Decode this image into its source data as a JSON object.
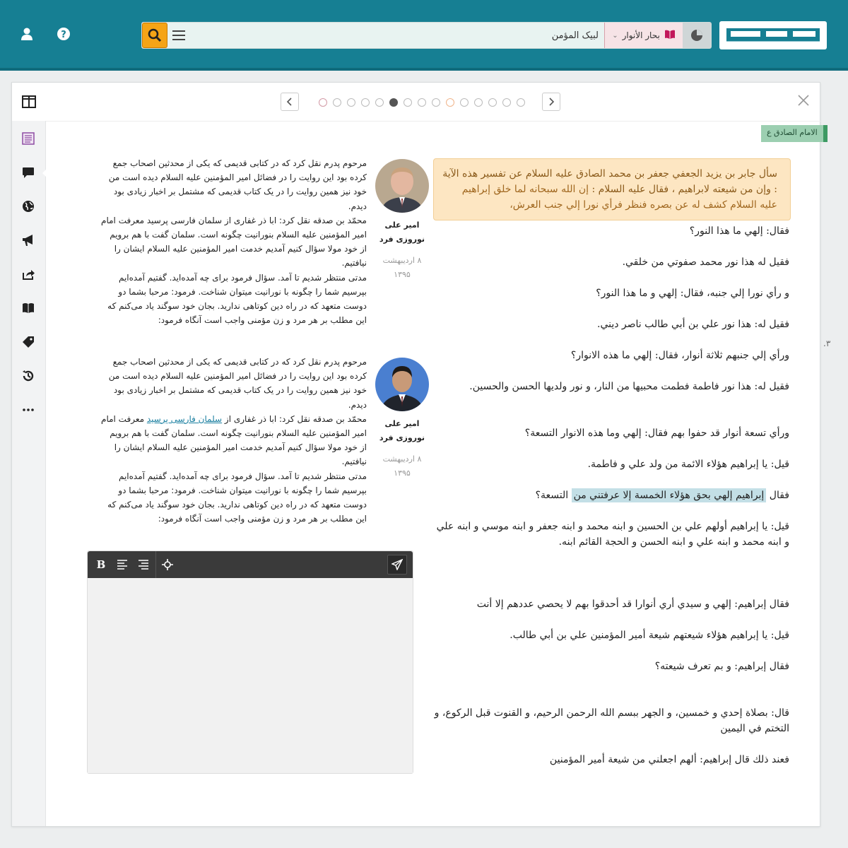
{
  "header": {
    "search": {
      "value": "لبیک المؤمن",
      "placeholder": ""
    },
    "book": {
      "label": "بحار الأنوار"
    },
    "icons": [
      "search-icon",
      "menu-icon",
      "book-icon",
      "pie-chart-icon",
      "help-icon",
      "user-icon"
    ],
    "colors": {
      "bar": "#167f93",
      "search_button": "#f5a416",
      "book_select": "#f6e3e6"
    }
  },
  "pager": {
    "page_count": 15,
    "active_index": 5,
    "marked_indices": [
      0,
      9
    ]
  },
  "hadith": {
    "tag": "الامام الصادق ع",
    "side_number": "۳.",
    "intro": "سأل جابر بن يزيد الجعفي جعفر بن محمد الصادق عليه السلام عن تفسير هذه الآية : وإن من شيعته لابراهيم ، فقال عليه السلام : ",
    "intro_body": "إن الله سبحانه لما خلق إبراهيم عليه السلام كشف له عن بصره فنظر فرأي نورا إلي جنب العرش،",
    "lines": [
      "فقال: إلهي ما هذا النور؟",
      "فقيل له هذا نور محمد صفوتي من خلقي.",
      "و رأي نورا إلي جنبه، فقال: إلهي و ما هذا النور؟",
      "فقيل له: هذا نور علي بن أبي طالب ناصر ديني.",
      "ورأي إلي جنبهم ثلاثة أنوار، فقال: إلهي ما هذه الانوار؟",
      "فقيل له: هذا نور فاطمة فطمت محبيها من النار، و نور ولديها الحسن والحسين.",
      "ورأي تسعة أنوار قد حفوا بهم فقال: إلهي وما هذه الانوار التسعة؟",
      "قيل: يا إبراهيم هؤلاء الائمة من ولد علي و فاطمة."
    ],
    "highlight_pre": "فقال ",
    "highlight": "إبراهيم إلهي بحق هؤلاء الخمسة إلا عرفتني من",
    "highlight_post": " التسعة؟",
    "lines2": [
      "قيل: يا إبراهيم أولهم علي بن الحسين و ابنه محمد و ابنه جعفر و ابنه موسي و ابنه علي و ابنه محمد و ابنه علي و ابنه الحسن و الحجة القائم ابنه.",
      "فقال إبراهيم: إلهي و سيدي أري أنوارا قد أحدقوا بهم لا يحصي عددهم إلا أنت",
      "قيل: يا إبراهيم هؤلاء شيعتهم شيعة أمير المؤمنين علي بن أبي طالب.",
      "فقال إبراهيم: و بم تعرف شيعته؟",
      "قال: بصلاة إحدي و خمسين، و الجهر ببسم الله الرحمن الرحيم، و القنوت قبل الركوع، و التختم في اليمين",
      "فعند ذلك قال إبراهيم: ألهم اجعلني من شيعة أمير المؤمنين"
    ]
  },
  "comments": [
    {
      "name": "امیر علی نوروزی فرد",
      "date": "۸ اردیبهشت ۱۳۹۵",
      "p1": "مرحوم پدرم نقل کرد که در کتابی قدیمی که یکی از محدثین اصحاب جمع کرده بود این روایت را در فضائل امیر المؤمنین علیه السلام دیده است من خود نیز همین روایت را در یک کتاب قدیمی که مشتمل بر اخبار زیادی بود دیدم.",
      "p2_pre": "محمّد بن صدقه نقل کرد: ابا ذر غفاری از سلمان فارسی پرسید معرفت امام امیر المؤمنین علیه السلام بنورانیت چگونه است. سلمان گفت با هم برویم از خود مولا سؤال کنیم آمدیم خدمت امیر المؤمنین علیه السلام ایشان را نیافتیم.",
      "p2_link": "",
      "p2_post": "",
      "p3": "مدتی منتظر شدیم تا آمد. سؤال فرمود برای چه آمده‌اید. گفتیم آمده‌ایم بپرسیم شما را چگونه با نورانیت میتوان شناخت. فرمود: مرحبا بشما دو دوست متعهد که در راه دین کوتاهی ندارید. بجان خود سوگند یاد می‌کنم که این مطلب بر هر مرد و زن مؤمنی واجب است آنگاه فرمود:"
    },
    {
      "name": "امیر علی نوروزی فرد",
      "date": "۸ اردیبهشت ۱۳۹۵",
      "p1": "مرحوم پدرم نقل کرد که در کتابی قدیمی که یکی از محدثین اصحاب جمع کرده بود این روایت را در فضائل امیر المؤمنین علیه السلام دیده است من خود نیز همین روایت را در یک کتاب قدیمی که مشتمل بر اخبار زیادی بود دیدم.",
      "p2_pre": "محمّد بن صدقه نقل کرد: ابا ذر غفاری از ",
      "p2_link": "سلمان فارسی پرسید",
      "p2_post": " معرفت امام امیر المؤمنین علیه السلام بنورانیت چگونه است. سلمان گفت با هم برویم از خود مولا سؤال کنیم آمدیم خدمت امیر المؤمنین علیه السلام ایشان را نیافتیم.",
      "p3": "مدتی منتظر شدیم تا آمد. سؤال فرمود برای چه آمده‌اید. گفتیم آمده‌ایم بپرسیم شما را چگونه با نورانیت میتوان شناخت. فرمود: مرحبا بشما دو دوست متعهد که در راه دین کوتاهی ندارید. بجان خود سوگند یاد می‌کنم که این مطلب بر هر مرد و زن مؤمنی واجب است آنگاه فرمود:"
    }
  ],
  "editor": {
    "bold_label": "B",
    "value": ""
  },
  "sidebar": {
    "icons": [
      "layout-toggle-icon",
      "list-icon",
      "comment-icon",
      "globe-icon",
      "megaphone-icon",
      "share-icon",
      "book-open-icon",
      "tag-icon",
      "history-icon",
      "more-icon"
    ]
  }
}
